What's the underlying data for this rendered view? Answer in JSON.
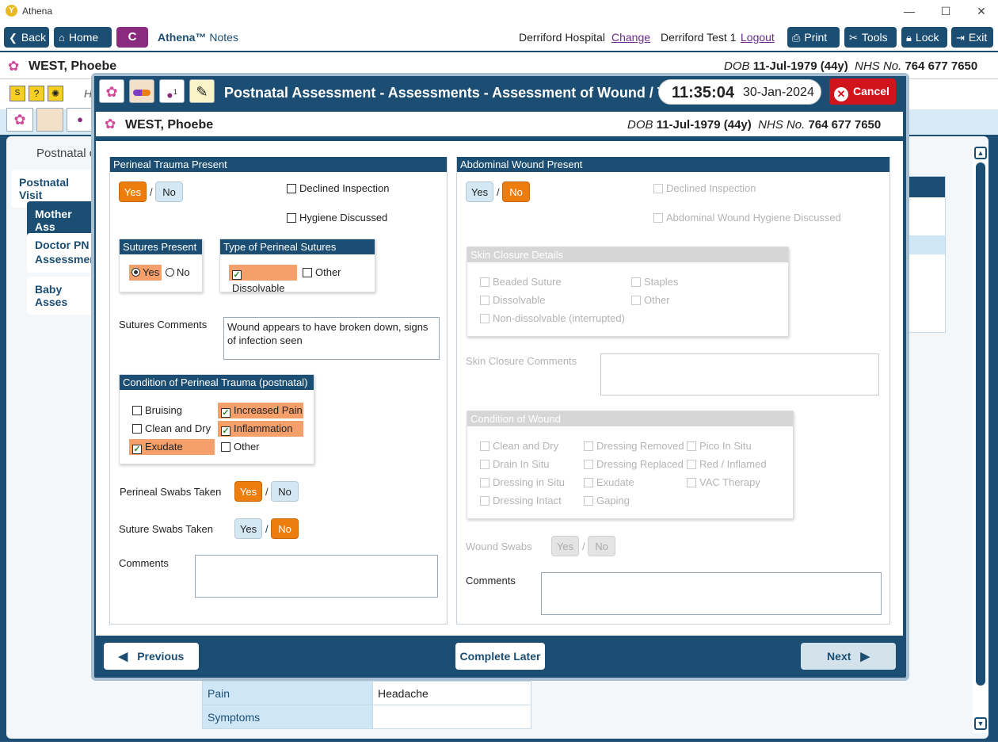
{
  "window": {
    "title": "Athena",
    "logo_glyph": "Y",
    "minimize": "—",
    "maximize": "☐",
    "close": "✕"
  },
  "toolbar": {
    "back": "Back",
    "home": "Home",
    "c_label": "C",
    "app_name": "Athena™",
    "app_sub": "Notes",
    "hospital": "Derriford Hospital",
    "change": "Change",
    "user": "Derriford Test 1",
    "logout": "Logout",
    "print": "Print",
    "tools": "Tools",
    "lock": "Lock",
    "exit": "Exit"
  },
  "patient": {
    "name": "WEST, Phoebe",
    "dob_label": "DOB",
    "dob": "11-Jul-1979 (44y)",
    "nhs_label": "NHS No.",
    "nhs": "764 677 7650"
  },
  "background": {
    "nav_h": "H",
    "breadcrumb": "Postnatal c",
    "side": [
      "Postnatal Visit",
      "Mother Ass",
      "Doctor PN Assessmen",
      "Baby Asses"
    ],
    "table": [
      {
        "label": "Pain",
        "value": "Headache"
      },
      {
        "label": "Symptoms",
        "value": ""
      }
    ]
  },
  "modal": {
    "title": "Postnatal Assessment - Assessments - Assessment of Wound / Trauma",
    "time": "11:35:04",
    "date": "30-Jan-2024",
    "cancel": "Cancel",
    "icon_badge": "1",
    "left": {
      "header": "Perineal Trauma Present",
      "yes": "Yes",
      "no": "No",
      "selected": "Yes",
      "declined": "Declined Inspection",
      "hygiene": "Hygiene Discussed",
      "sutures_present": {
        "header": "Sutures Present",
        "yes": "Yes",
        "no": "No",
        "selected": "Yes"
      },
      "suture_type": {
        "header": "Type of Perineal Sutures",
        "dissolvable": "Dissolvable",
        "other": "Other"
      },
      "sutures_comments_label": "Sutures Comments",
      "sutures_comments": "Wound appears to have broken down, signs of infection seen",
      "condition": {
        "header": "Condition of Perineal Trauma (postnatal)",
        "bruising": "Bruising",
        "increased_pain": "Increased Pain",
        "clean_dry": "Clean and Dry",
        "inflammation": "Inflammation",
        "exudate": "Exudate",
        "other": "Other"
      },
      "perineal_swabs": {
        "label": "Perineal Swabs Taken",
        "selected": "Yes"
      },
      "suture_swabs": {
        "label": "Suture Swabs Taken",
        "selected": "No"
      },
      "comments_label": "Comments",
      "comments": ""
    },
    "right": {
      "header": "Abdominal Wound Present",
      "yes": "Yes",
      "no": "No",
      "selected": "No",
      "declined": "Declined Inspection",
      "hygiene": "Abdominal Wound Hygiene Discussed",
      "skin_closure": {
        "header": "Skin Closure Details",
        "items": [
          "Beaded Suture",
          "Staples",
          "Dissolvable",
          "Other",
          "Non-dissolvable (interrupted)"
        ]
      },
      "skin_comments_label": "Skin Closure Comments",
      "skin_comments": "",
      "condition": {
        "header": "Condition of Wound",
        "col1": [
          "Clean and Dry",
          "Drain In Situ",
          "Dressing in Situ",
          "Dressing Intact"
        ],
        "col2": [
          "Dressing Removed",
          "Dressing Replaced",
          "Exudate",
          "Gaping"
        ],
        "col3": [
          "Pico In Situ",
          "Red / Inflamed",
          "VAC Therapy"
        ]
      },
      "wound_swabs_label": "Wound Swabs",
      "comments_label": "Comments",
      "comments": ""
    },
    "footer": {
      "previous": "Previous",
      "complete_later": "Complete Later",
      "next": "Next"
    }
  },
  "colors": {
    "primary": "#1b4e72",
    "selected": "#ee7d10",
    "highlight": "#f5a06a",
    "cancel": "#d1141b"
  }
}
